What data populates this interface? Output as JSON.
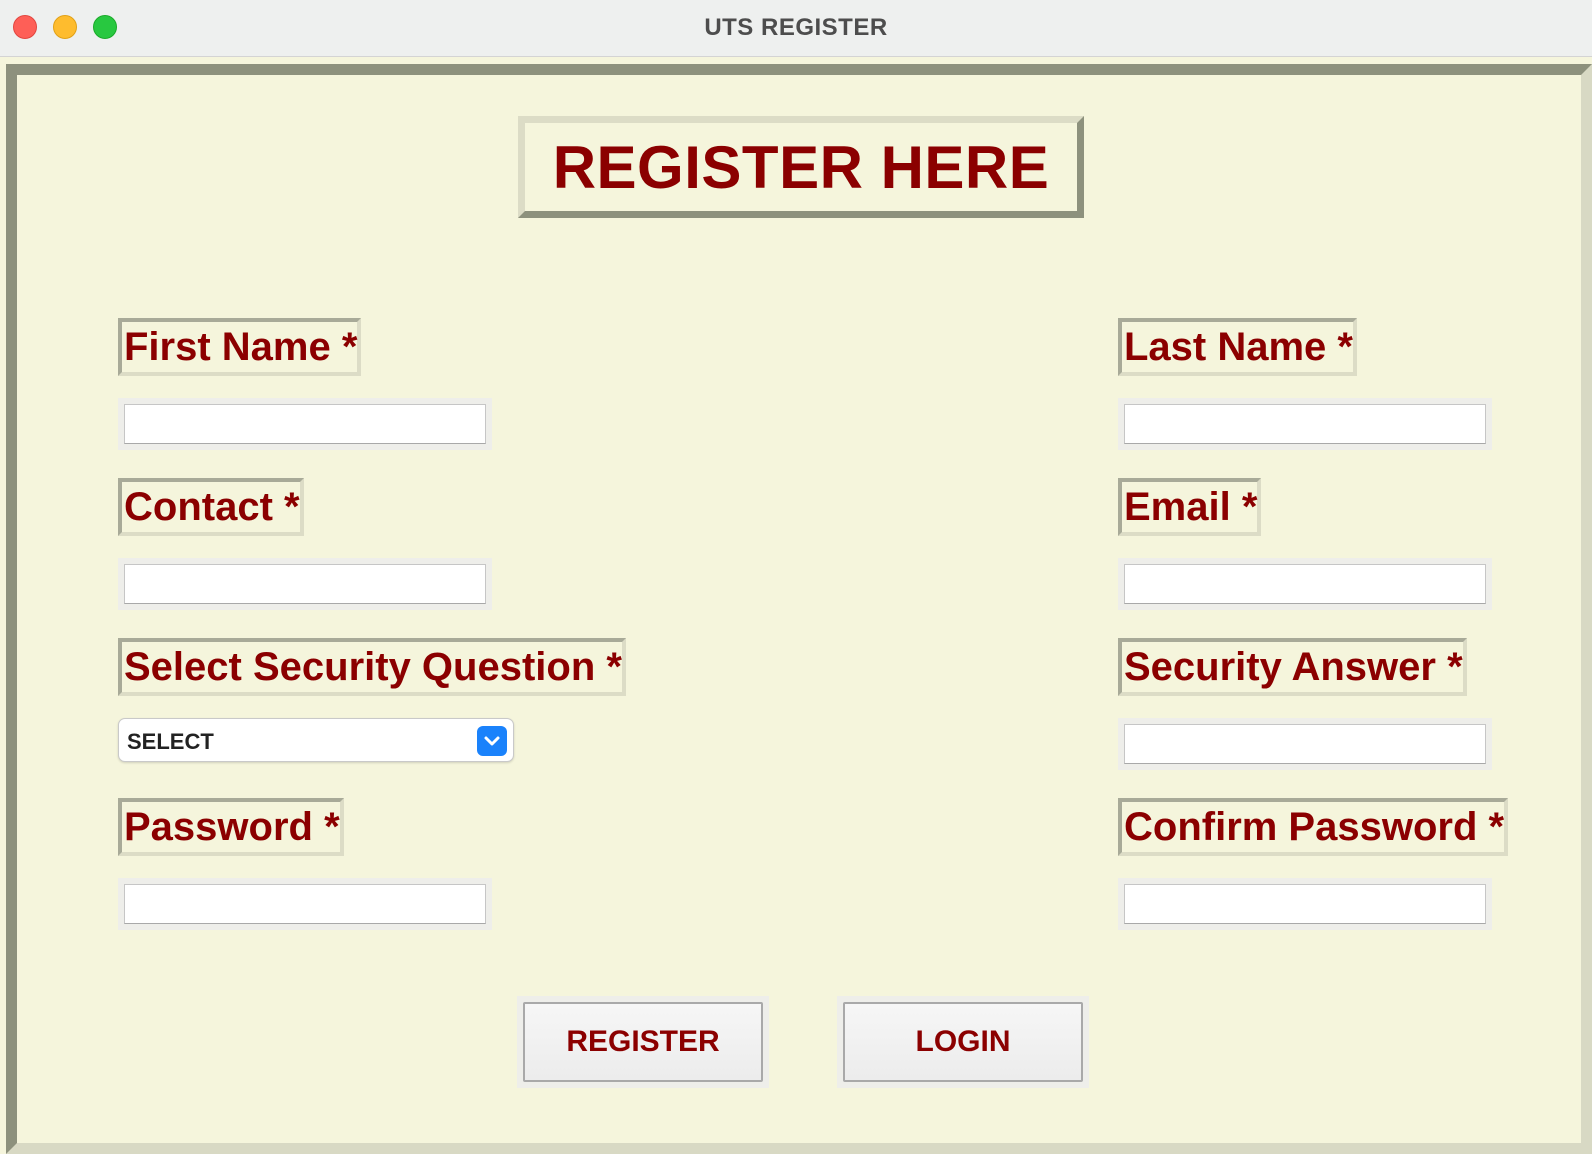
{
  "window": {
    "title": "UTS REGISTER"
  },
  "heading": "REGISTER HERE",
  "fields": {
    "first_name": {
      "label": "First Name  *",
      "value": ""
    },
    "last_name": {
      "label": "Last Name  *",
      "value": ""
    },
    "contact": {
      "label": "Contact  *",
      "value": ""
    },
    "email": {
      "label": "Email  *",
      "value": ""
    },
    "security_question": {
      "label": "Select Security Question  *",
      "selected": "SELECT"
    },
    "security_answer": {
      "label": "Security Answer  *",
      "value": ""
    },
    "password": {
      "label": "Password  *",
      "value": ""
    },
    "confirm_password": {
      "label": "Confirm Password  *",
      "value": ""
    }
  },
  "buttons": {
    "register": "REGISTER",
    "login": "LOGIN"
  },
  "colors": {
    "background": "#f5f5dc",
    "text": "#8b0000",
    "select_accent": "#1a82fb"
  },
  "icons": {
    "select_arrow": "chevron-down-icon"
  }
}
